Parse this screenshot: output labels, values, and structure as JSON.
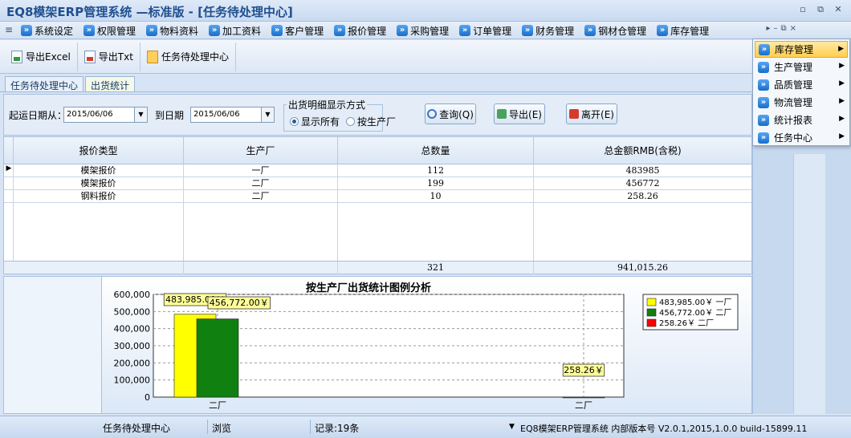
{
  "window": {
    "title": "EQ8模架ERP管理系统 —标准版 - [任务待处理中心]"
  },
  "window_controls": {
    "minimize": "▫",
    "restore": "⧉",
    "close": "✕"
  },
  "mdi_controls": {
    "arrow": "▸",
    "minimize": "–",
    "restore": "⧉",
    "close": "×"
  },
  "menu": {
    "grip": "≡",
    "items": [
      {
        "label": "系统设定"
      },
      {
        "label": "权限管理"
      },
      {
        "label": "物料资料"
      },
      {
        "label": "加工资料"
      },
      {
        "label": "客户管理"
      },
      {
        "label": "报价管理"
      },
      {
        "label": "采购管理"
      },
      {
        "label": "订单管理"
      },
      {
        "label": "财务管理"
      },
      {
        "label": "钢材仓管理"
      },
      {
        "label": "库存管理"
      }
    ],
    "arrow_glyph": "»"
  },
  "toolbar": {
    "export_excel": "导出Excel",
    "export_txt": "导出Txt",
    "task_center": "任务待处理中心"
  },
  "doc_tabs": [
    {
      "label": "任务待处理中心"
    },
    {
      "label": "出货统计"
    }
  ],
  "filter": {
    "start_label": "起运日期从：",
    "start_value": "2015/06/06",
    "end_label": "到日期",
    "end_value": "2015/06/06",
    "group_title": "出货明细显示方式",
    "radio_all": "显示所有",
    "radio_factory": "按生产厂",
    "query_button": "查询(Q)",
    "export_button": "导出(E)",
    "exit_button": "离开(E)",
    "dropdown_glyph": "▼"
  },
  "grid": {
    "columns": [
      "报价类型",
      "生产厂",
      "总数量",
      "总金额RMB(含税)"
    ],
    "rows": [
      {
        "type": "模架报价",
        "factory": "一厂",
        "qty": "112",
        "amount": "483985"
      },
      {
        "type": "模架报价",
        "factory": "二厂",
        "qty": "199",
        "amount": "456772"
      },
      {
        "type": "钢料报价",
        "factory": "二厂",
        "qty": "10",
        "amount": "258.26"
      }
    ],
    "current_row_marker": "▶",
    "totals": {
      "qty": "321",
      "amount": "941,015.26"
    }
  },
  "chart_data": {
    "type": "bar",
    "title": "按生产厂出货统计图例分析",
    "categories": [
      "二厂",
      "二厂"
    ],
    "series": [
      {
        "name": "一厂",
        "legend": "483,985.00￥  一厂",
        "color": "#ffff00",
        "values": [
          483985,
          null
        ]
      },
      {
        "name": "二厂",
        "legend": "456,772.00￥  二厂",
        "color": "#108010",
        "values": [
          456772,
          null
        ]
      },
      {
        "name": "二厂",
        "legend": "258.26￥  二厂",
        "color": "#ff0000",
        "values": [
          null,
          258.26
        ]
      }
    ],
    "data_labels": [
      "483,985.00￥",
      "456,772.00￥",
      "258.26￥"
    ],
    "yticks": [
      "600,000",
      "500,000",
      "400,000",
      "300,000",
      "200,000",
      "100,000",
      "0"
    ],
    "ylim": [
      0,
      600000
    ],
    "grid": true,
    "legend_position": "right"
  },
  "right_menu": {
    "items": [
      {
        "label": "库存管理"
      },
      {
        "label": "生产管理"
      },
      {
        "label": "品质管理"
      },
      {
        "label": "物流管理"
      },
      {
        "label": "统计报表"
      },
      {
        "label": "任务中心"
      }
    ],
    "submenu_glyph": "▶",
    "highlighted_index": 0
  },
  "status": {
    "module": "任务待处理中心",
    "mode": "浏览",
    "records": "记录:19条",
    "dropdown_glyph": "▼",
    "version": "EQ8模架ERP管理系统 内部版本号  V2.0.1,2015,1.0.0 build-15899.11"
  }
}
